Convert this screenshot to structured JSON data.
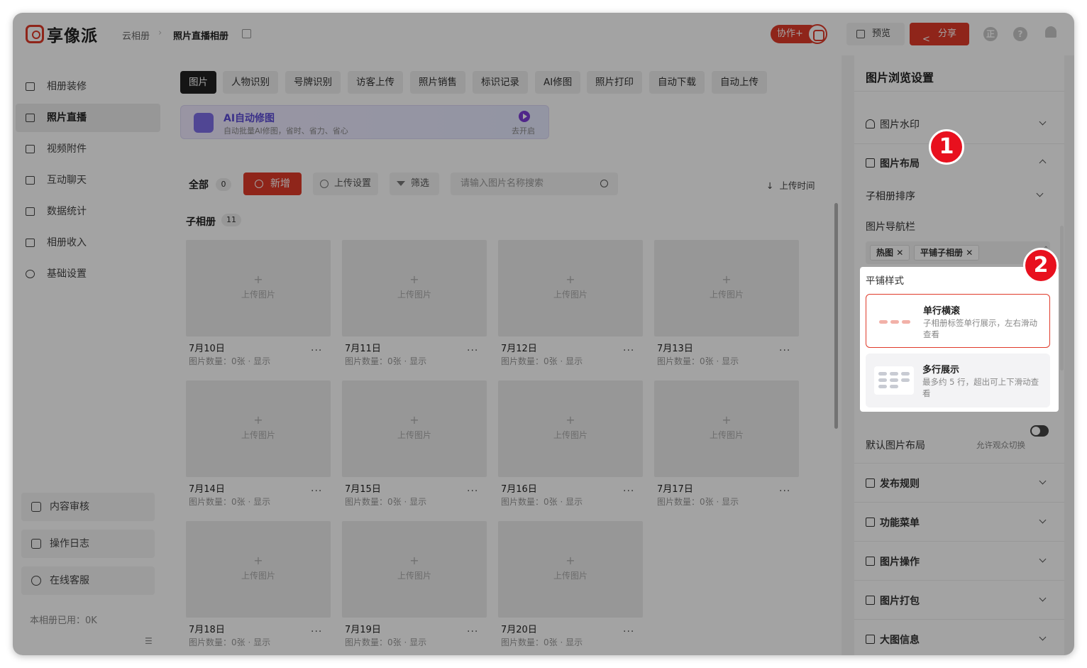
{
  "header": {
    "logo": "享像派",
    "breadcrumb_root": "云相册",
    "breadcrumb_current": "照片直播相册",
    "collab_label": "协作+",
    "preview_label": "预览",
    "share_label": "分享",
    "user_initial": "正",
    "help_glyph": "?"
  },
  "sidebar": {
    "items": [
      {
        "label": "相册装修",
        "icon": "decoration-icon"
      },
      {
        "label": "照片直播",
        "icon": "photo-live-icon",
        "active": true
      },
      {
        "label": "视频附件",
        "icon": "paperclip-icon"
      },
      {
        "label": "互动聊天",
        "icon": "chat-icon"
      },
      {
        "label": "数据统计",
        "icon": "stats-icon"
      },
      {
        "label": "相册收入",
        "icon": "wallet-icon"
      },
      {
        "label": "基础设置",
        "icon": "gear-icon"
      }
    ],
    "bottom": [
      {
        "label": "内容审核",
        "icon": "review-icon"
      },
      {
        "label": "操作日志",
        "icon": "log-icon"
      },
      {
        "label": "在线客服",
        "icon": "headset-icon"
      }
    ],
    "usage": "本相册已用：0K"
  },
  "main": {
    "tabs": [
      "图片",
      "人物识别",
      "号牌识别",
      "访客上传",
      "照片销售",
      "标识记录",
      "AI修图",
      "照片打印",
      "自动下载",
      "自动上传"
    ],
    "banner": {
      "title": "AI自动修图",
      "subtitle": "自动批量AI修图，省时、省力、省心",
      "action": "去开启"
    },
    "toolbar": {
      "all_label": "全部",
      "all_count": "0",
      "add_label": "新增",
      "upload_settings": "上传设置",
      "filter": "筛选",
      "search_placeholder": "请输入图片名称搜索",
      "sort": "上传时间"
    },
    "sub_albums": {
      "label": "子相册",
      "count": "11",
      "upload_text": "上传图片",
      "items": [
        {
          "title": "7月10日",
          "meta": "图片数量：0张 · 显示"
        },
        {
          "title": "7月11日",
          "meta": "图片数量：0张 · 显示"
        },
        {
          "title": "7月12日",
          "meta": "图片数量：0张 · 显示"
        },
        {
          "title": "7月13日",
          "meta": "图片数量：0张 · 显示"
        },
        {
          "title": "7月14日",
          "meta": "图片数量：0张 · 显示"
        },
        {
          "title": "7月15日",
          "meta": "图片数量：0张 · 显示"
        },
        {
          "title": "7月16日",
          "meta": "图片数量：0张 · 显示"
        },
        {
          "title": "7月17日",
          "meta": "图片数量：0张 · 显示"
        },
        {
          "title": "7月18日",
          "meta": "图片数量：0张 · 显示"
        },
        {
          "title": "7月19日",
          "meta": "图片数量：0张 · 显示"
        },
        {
          "title": "7月20日",
          "meta": "图片数量：0张 · 显示"
        }
      ]
    }
  },
  "right_panel": {
    "title": "图片浏览设置",
    "watermark": "图片水印",
    "layout": "图片布局",
    "sub_sort": "子相册排序",
    "nav_bar": "图片导航栏",
    "tags": [
      "热图",
      "平铺子相册"
    ],
    "tile_style": {
      "label": "平铺样式",
      "options": [
        {
          "title": "单行横滚",
          "desc": "子相册标签单行展示，左右滑动查看",
          "selected": true
        },
        {
          "title": "多行展示",
          "desc": "最多约 5 行，超出可上下滑动查看",
          "selected": false
        }
      ]
    },
    "default_layout": "默认图片布局",
    "allow_switch": "允许观众切换",
    "sections": [
      "发布规则",
      "功能菜单",
      "图片操作",
      "图片打包",
      "大图信息"
    ]
  },
  "annotations": [
    "1",
    "2"
  ],
  "colors": {
    "accent": "#e03a2a",
    "badge": "#e8101e"
  }
}
